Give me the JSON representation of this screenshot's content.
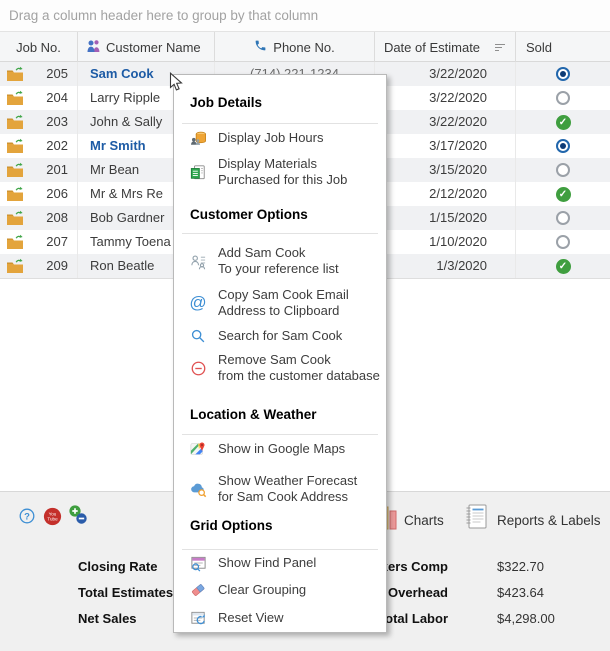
{
  "drag_band": {
    "text": "Drag a column header here to group by that column"
  },
  "table": {
    "headers": {
      "job": "Job No.",
      "customer": "Customer Name",
      "phone": "Phone No.",
      "date": "Date of Estimate",
      "sold": "Sold"
    },
    "rows": [
      {
        "job": "205",
        "name": "Sam Cook",
        "phone": "(714) 221-1234",
        "date": "3/22/2020",
        "sold": "radio-selected",
        "emphasis": true
      },
      {
        "job": "204",
        "name": "Larry Ripple",
        "phone": "",
        "date": "3/22/2020",
        "sold": "radio-empty",
        "emphasis": false
      },
      {
        "job": "203",
        "name": "John & Sally",
        "phone": "",
        "date": "3/22/2020",
        "sold": "check",
        "emphasis": false
      },
      {
        "job": "202",
        "name": "Mr Smith",
        "phone": "",
        "date": "3/17/2020",
        "sold": "radio-selected",
        "emphasis": true
      },
      {
        "job": "201",
        "name": "Mr Bean",
        "phone": "",
        "date": "3/15/2020",
        "sold": "radio-empty",
        "emphasis": false
      },
      {
        "job": "206",
        "name": "Mr & Mrs Re",
        "phone": "",
        "date": "2/12/2020",
        "sold": "check",
        "emphasis": false
      },
      {
        "job": "208",
        "name": "Bob Gardner",
        "phone": "",
        "date": "1/15/2020",
        "sold": "radio-empty",
        "emphasis": false
      },
      {
        "job": "207",
        "name": "Tammy Toena",
        "phone": "",
        "date": "1/10/2020",
        "sold": "radio-empty",
        "emphasis": false
      },
      {
        "job": "209",
        "name": "Ron Beatle",
        "phone": "",
        "date": "1/3/2020",
        "sold": "check",
        "emphasis": false
      }
    ]
  },
  "context_menu": {
    "sections": [
      {
        "header": "Job Details",
        "items": [
          {
            "icon": "job-hours-icon",
            "lines": [
              "Display Job Hours"
            ]
          },
          {
            "icon": "materials-icon",
            "lines": [
              "Display Materials",
              "Purchased for this Job"
            ]
          }
        ]
      },
      {
        "header": "Customer Options",
        "items": [
          {
            "icon": "add-to-reference-icon",
            "lines": [
              "Add Sam Cook",
              "To your reference list"
            ]
          },
          {
            "icon": "email-at-icon",
            "lines": [
              "Copy Sam Cook Email",
              "Address to Clipboard"
            ]
          },
          {
            "icon": "search-icon",
            "lines": [
              "Search for Sam Cook"
            ]
          },
          {
            "icon": "remove-customer-icon",
            "lines": [
              "Remove Sam Cook",
              "from the customer database"
            ]
          }
        ]
      },
      {
        "header": "Location & Weather",
        "items": [
          {
            "icon": "google-maps-icon",
            "lines": [
              "Show in Google Maps"
            ]
          },
          {
            "icon": "weather-forecast-icon",
            "lines": [
              "Show Weather Forecast",
              "for Sam Cook Address"
            ]
          }
        ]
      },
      {
        "header": "Grid Options",
        "items": [
          {
            "icon": "find-panel-icon",
            "lines": [
              "Show Find Panel"
            ]
          },
          {
            "icon": "clear-grouping-icon",
            "lines": [
              "Clear Grouping"
            ]
          },
          {
            "icon": "reset-view-icon",
            "lines": [
              "Reset View"
            ]
          }
        ]
      }
    ]
  },
  "footer": {
    "charts_label": "Charts",
    "reports_label": "Reports & Labels",
    "left_stats": [
      {
        "label": "Closing Rate"
      },
      {
        "label": "Total Estimates"
      },
      {
        "label": "Net Sales"
      }
    ],
    "right_stats": [
      {
        "label": "Workers Comp",
        "value": "$322.70"
      },
      {
        "label": "Overhead",
        "value": "$423.64"
      },
      {
        "label": "Total Labor",
        "value": "$4,298.00"
      }
    ]
  },
  "icons": {
    "customer-header-icon": "two-people",
    "phone-header-icon": "phone-handset",
    "sort-icon": "sort-lines",
    "folder-icon": "open-folder-with-green-arrow",
    "help-icon": "?",
    "youtube-icon": "youtube-circle",
    "add-remove-icon": "plus-minus-circles",
    "charts-icon": "bar-chart",
    "reports-icon": "spiral-notepad"
  },
  "colors": {
    "accent_blue": "#1d5ba5",
    "radio_blue": "#2166ac",
    "check_green": "#3f9e3f",
    "menu_bg": "#ffffff",
    "footer_bg": "#f0f0f0",
    "alt_row": "#f0f1f3"
  },
  "cursor": {
    "type": "arrow"
  }
}
